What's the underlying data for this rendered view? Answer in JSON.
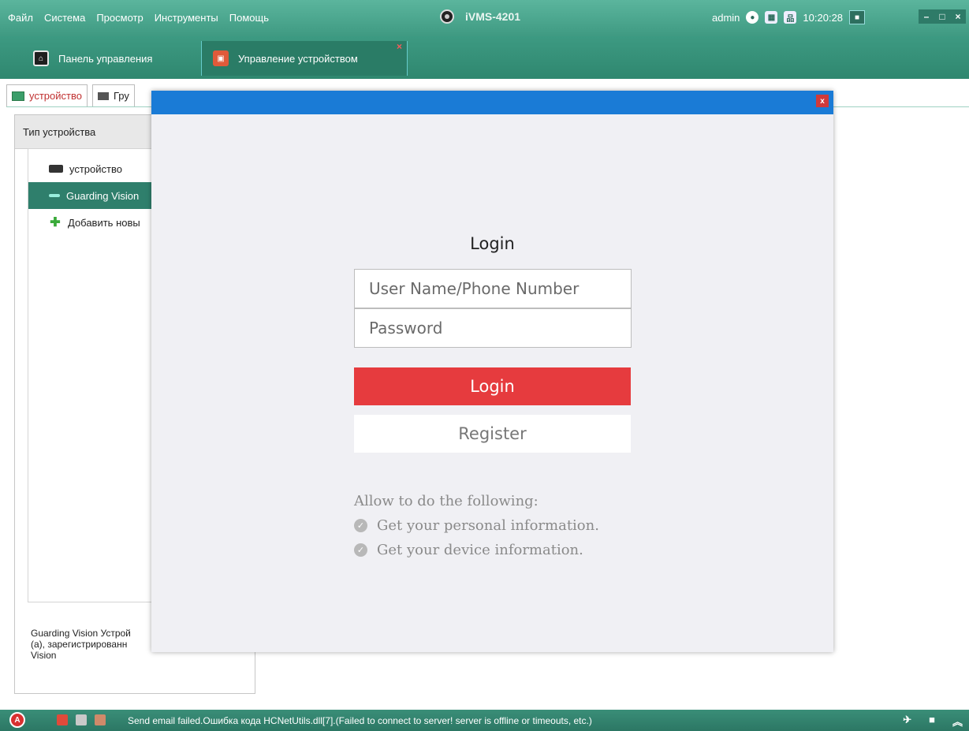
{
  "menu": {
    "items": [
      "Файл",
      "Система",
      "Просмотр",
      "Инструменты",
      "Помощь"
    ]
  },
  "app": {
    "title": "iVMS-4201",
    "logo_icon": "camera-lens-icon"
  },
  "topright": {
    "user": "admin",
    "clock": "10:20:28",
    "icons": [
      "globe-icon",
      "cpu-icon",
      "network-icon",
      "lock-icon"
    ]
  },
  "window_controls": {
    "minimize": "–",
    "maximize": "□",
    "close": "×"
  },
  "tabs": [
    {
      "label": "Панель управления",
      "icon": "home-icon"
    },
    {
      "label": "Управление устройством",
      "icon": "device-management-icon",
      "close": "×"
    }
  ],
  "subtabs": [
    {
      "label": "устройство",
      "active": true
    },
    {
      "label": "Гру"
    }
  ],
  "device_panel": {
    "header": "Тип устройства",
    "items": [
      {
        "label": "устройство",
        "icon": "dvr-icon",
        "selected": false
      },
      {
        "label": "Guarding Vision",
        "icon": "cloud-device-icon",
        "selected": true
      },
      {
        "label": "Добавить новы",
        "icon": "add-icon",
        "selected": false
      }
    ],
    "description_lines": [
      "Guarding Vision Устрой",
      "(а), зарегистрированн",
      "Vision"
    ]
  },
  "modal": {
    "close": "x",
    "title": "Login",
    "username_placeholder": "User Name/Phone Number",
    "password_placeholder": "Password",
    "login_button": "Login",
    "register_button": "Register",
    "permissions_title": "Allow to do the following:",
    "permissions": [
      "Get your personal information.",
      "Get your device information."
    ],
    "colors": {
      "header": "#1a7bd6",
      "login_button": "#e63b3e"
    }
  },
  "status": {
    "message": "Send email failed.Ошибка кода HCNetUtils.dll[7].(Failed to connect to server! server is offline or timeouts, etc.)",
    "right_icons": [
      "pin-icon",
      "restore-icon",
      "collapse-up-icon"
    ]
  }
}
